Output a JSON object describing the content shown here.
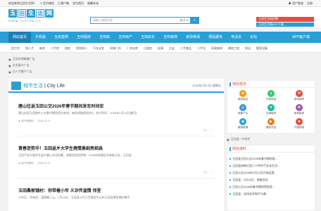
{
  "topbar": {
    "welcome": "欢迎来到玉田生活网！",
    "links": [
      "官方微信",
      "客户端",
      "设为首页",
      "收藏本站"
    ],
    "right": [
      "用户登录",
      "注册"
    ]
  },
  "logo": {
    "chars": [
      "玉",
      "田",
      "生",
      "活",
      "网"
    ],
    "domain": "WWW.YUTIAN.CC"
  },
  "search": {
    "placeholder": "请输入搜索内容",
    "category": "帖子",
    "button_icon": "search-icon"
  },
  "header_banner": [
    "玉田生活网招聘",
    "玉田生活网APP下载"
  ],
  "nav": {
    "items": [
      "网站首页",
      "手机版",
      "玉田直聘",
      "玉田租房",
      "玉田房",
      "玉田房产",
      "玉田房车",
      "玉田装修",
      "家政维保",
      "便民服务",
      "电话本",
      "论坛"
    ],
    "app_label": "APP客户端"
  },
  "subnav": [
    "找工作",
    "找人才",
    "新房",
    "二手房",
    "租房",
    "找到知人",
    "汽车买卖",
    "同城门市",
    "厂房仓库",
    "日租房",
    "征婚",
    "交友",
    "二手物品",
    "二手车",
    "家政维修",
    "建筑工程",
    "保洁",
    "搬家设备"
  ],
  "ads": [
    "玉田本地精美广告",
    "文艺复兴广告",
    "点人才客户广告"
  ],
  "section": {
    "title_cn": "城市生活",
    "title_en": "City Life",
    "date": "2026年2月13日 星期五"
  },
  "articles": [
    {
      "title": "唐山往返玉田公交2026年春节期间发车时间安",
      "summary": "唐山往返玉田城乡公交春节期间班次安排，每条线路首班4时，执行时间：2026年2月14日(腊月)",
      "author": "城气和春秋",
      "date": "2026-02-11"
    },
    {
      "title": "青春逆势华！玉田返乡大学生携情景剧亮相县",
      "summary": "玉田平安大道学生返乡暖心活动启幕，青春逆势追梦想，2026年新春佳节来临之际，玉田县",
      "author": "城气和春秋",
      "date": "2026-02-11"
    },
    {
      "title": "玉田桑家铺村：你带着小年 义诊传温情 邻里",
      "summary": "小年至，年味浓，温情暖人心。1月18日，玉田县公共卫生服务中心和玉田县桑家铺村携手",
      "author": "城气和春秋",
      "date": "2026-02-11"
    }
  ],
  "sidebar": {
    "service_title": "便民服务",
    "services": [
      {
        "label": "家政保洁",
        "icon": "broom-icon",
        "color": "#f39c12"
      },
      {
        "label": "开锁修锁",
        "icon": "key-icon",
        "color": "#2ecc71"
      },
      {
        "label": "家电维修",
        "icon": "wrench-icon",
        "color": "#e74c3c"
      },
      {
        "label": "疏通下水",
        "icon": "pipe-icon",
        "color": "#3498db"
      },
      {
        "label": "空调维修",
        "icon": "snowflake-icon",
        "color": "#1abc9c"
      },
      {
        "label": "家具维修",
        "icon": "hammer-icon",
        "color": "#9b59b6"
      },
      {
        "label": "管道疏通",
        "icon": "drain-icon",
        "color": "#2a9fd6"
      },
      {
        "label": "搬家货运",
        "icon": "truck-icon",
        "color": "#e67e22"
      },
      {
        "label": "开锁换锁",
        "icon": "lock-icon",
        "color": "#e84c3d"
      }
    ],
    "ad_text": "玉田县一中学栏",
    "news_title": "网友爆料",
    "news": [
      "玉田县玉田公交2026年春节期间发...",
      "玉田县创新打造二十四节气文化生活...",
      "玉田公交2026年2月12日开始运营...",
      "玉田县：3月15日，调查诉讼",
      "玉田公交2026年春节期间停发班...",
      "玉田县：支持北京和平与普..."
    ]
  }
}
